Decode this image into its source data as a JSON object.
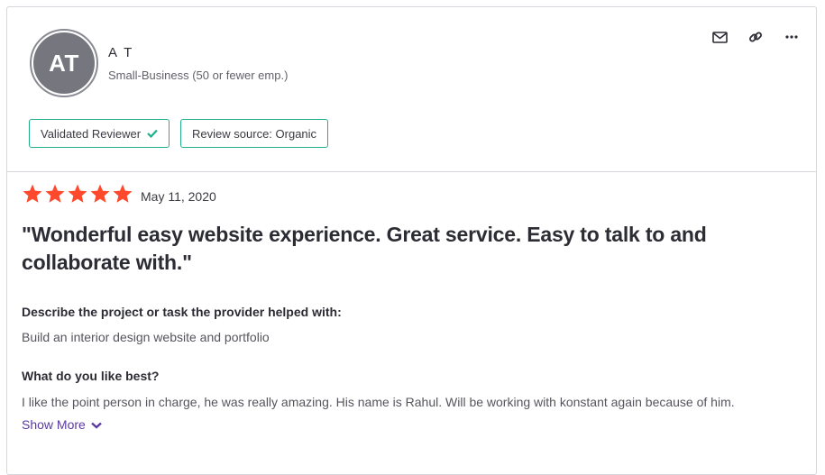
{
  "reviewer": {
    "initials": "AT",
    "name": "A T",
    "company_size": "Small-Business (50 or fewer emp.)"
  },
  "actions": {
    "icons": [
      "mail-icon",
      "link-icon",
      "more-icon"
    ]
  },
  "badges": {
    "validated": "Validated Reviewer",
    "source": "Review source: Organic"
  },
  "review": {
    "rating": 5,
    "max_rating": 5,
    "date": "May 11, 2020",
    "title": "\"Wonderful easy website experience. Great service. Easy to talk to and collaborate with.\"",
    "questions": [
      {
        "question": "Describe the project or task the provider helped with:",
        "answer": "Build an interior design website and portfolio"
      },
      {
        "question": "What do you like best?",
        "answer": "I like the point person in charge, he was really amazing. His name is Rahul. Will be working with konstant again because of him."
      }
    ],
    "show_more": "Show More"
  },
  "colors": {
    "star": "#ff492c",
    "badge_border": "#22b08a",
    "checkmark": "#22b08a",
    "link": "#5a3aa0",
    "avatar_bg": "#76767f"
  }
}
